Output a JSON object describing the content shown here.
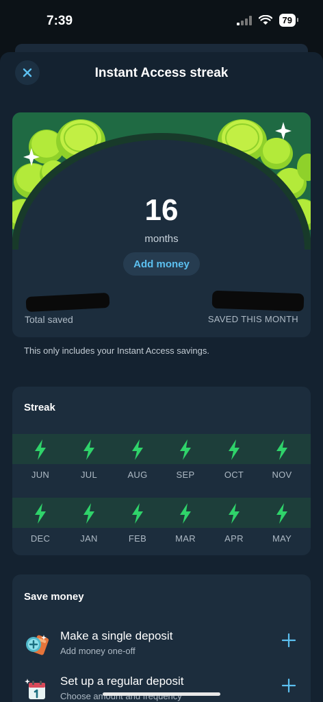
{
  "status": {
    "time": "7:39",
    "battery": "79"
  },
  "header": {
    "title": "Instant Access streak"
  },
  "hero": {
    "count": "16",
    "unit": "months",
    "add_money_label": "Add money",
    "total_saved_label": "Total saved",
    "saved_this_month_label": "SAVED THIS MONTH",
    "note": "This only includes your Instant Access savings."
  },
  "streak": {
    "heading": "Streak",
    "rows": [
      [
        "JUN",
        "JUL",
        "AUG",
        "SEP",
        "OCT",
        "NOV"
      ],
      [
        "DEC",
        "JAN",
        "FEB",
        "MAR",
        "APR",
        "MAY"
      ]
    ]
  },
  "save_money": {
    "heading": "Save money",
    "options": [
      {
        "title": "Make a single deposit",
        "subtitle": "Add money one-off"
      },
      {
        "title": "Set up a regular deposit",
        "subtitle": "Choose amount and frequency"
      }
    ]
  },
  "colors": {
    "accent_blue": "#5cc0f0",
    "bolt_green": "#2fd36a",
    "coin_green": "#a4e02c",
    "card_bg": "#1c2d3d"
  }
}
